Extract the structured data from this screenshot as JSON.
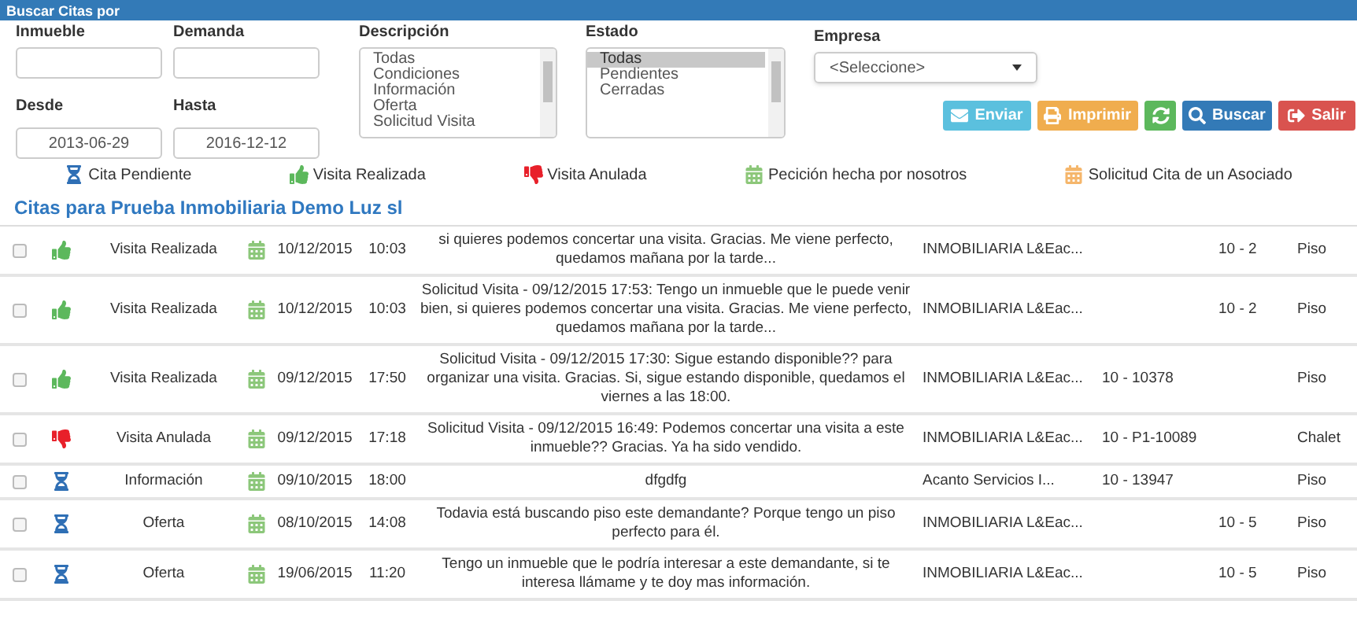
{
  "panel_title": "Buscar Citas por",
  "fields": {
    "inmueble": {
      "label": "Inmueble"
    },
    "demanda": {
      "label": "Demanda"
    },
    "desde": {
      "label": "Desde",
      "value": "2013-06-29"
    },
    "hasta": {
      "label": "Hasta",
      "value": "2016-12-12"
    }
  },
  "descripcion": {
    "label": "Descripción",
    "options": [
      {
        "label": "Todas",
        "selected": false
      },
      {
        "label": "Condiciones",
        "selected": false
      },
      {
        "label": "Información",
        "selected": false
      },
      {
        "label": "Oferta",
        "selected": false
      },
      {
        "label": "Solicitud Visita",
        "selected": false
      }
    ]
  },
  "estado": {
    "label": "Estado",
    "options": [
      {
        "label": "Todas",
        "selected": true
      },
      {
        "label": "Pendientes",
        "selected": false
      },
      {
        "label": "Cerradas",
        "selected": false
      }
    ]
  },
  "empresa": {
    "label": "Empresa",
    "value": "<Seleccione>"
  },
  "buttons": [
    {
      "kind": "send",
      "label": "Enviar"
    },
    {
      "kind": "print",
      "label": "Imprimir"
    },
    {
      "kind": "refresh"
    },
    {
      "kind": "search",
      "label": "Buscar"
    },
    {
      "kind": "exit",
      "label": "Salir"
    }
  ],
  "legend": [
    {
      "kind": "pending",
      "label": "Cita Pendiente"
    },
    {
      "kind": "done",
      "label": "Visita Realizada"
    },
    {
      "kind": "cancelled",
      "label": "Visita Anulada"
    },
    {
      "kind": "own",
      "label": "Pecición hecha por nosotros"
    },
    {
      "kind": "associate",
      "label": "Solicitud Cita de un Asociado"
    }
  ],
  "heading": "Citas para Prueba Inmobiliaria Demo Luz sl",
  "rows": [
    {
      "checked": false,
      "kind": "done",
      "own": true,
      "type": "Visita Realizada",
      "date": "10/12/2015",
      "time": "10:03",
      "description": "si quieres podemos concertar una visita. Gracias. Me viene perfecto, quedamos mañana por la tarde...",
      "company": "INMOBILIARIA L&Eac...",
      "inmueble": "",
      "demanda": "10 - 2",
      "tipo": "Piso"
    },
    {
      "checked": false,
      "kind": "done",
      "own": true,
      "type": "Visita Realizada",
      "date": "10/12/2015",
      "time": "10:03",
      "description": "Solicitud Visita - 09/12/2015 17:53: Tengo un inmueble que le puede venir bien, si quieres podemos concertar una visita. Gracias. Me viene perfecto, quedamos mañana por la tarde...",
      "company": "INMOBILIARIA L&Eac...",
      "inmueble": "",
      "demanda": "10 - 2",
      "tipo": "Piso"
    },
    {
      "checked": false,
      "kind": "done",
      "own": true,
      "type": "Visita Realizada",
      "date": "09/12/2015",
      "time": "17:50",
      "description": "Solicitud Visita - 09/12/2015 17:30: Sigue estando disponible?? para organizar una visita. Gracias. Si, sigue estando disponible, quedamos el viernes a las 18:00.",
      "company": "INMOBILIARIA L&Eac...",
      "inmueble": "10 - 10378",
      "demanda": "",
      "tipo": "Piso"
    },
    {
      "checked": false,
      "kind": "cancelled",
      "own": true,
      "type": "Visita Anulada",
      "date": "09/12/2015",
      "time": "17:18",
      "description": "Solicitud Visita - 09/12/2015 16:49: Podemos concertar una visita a este inmueble?? Gracias. Ya ha sido vendido.",
      "company": "INMOBILIARIA L&Eac...",
      "inmueble": "10 - P1-10089",
      "demanda": "",
      "tipo": "Chalet"
    },
    {
      "checked": false,
      "kind": "pending",
      "own": true,
      "type": "Información",
      "date": "09/10/2015",
      "time": "18:00",
      "description": "dfgdfg",
      "company": "Acanto Servicios I...",
      "inmueble": "10 - 13947",
      "demanda": "",
      "tipo": "Piso"
    },
    {
      "checked": false,
      "kind": "pending",
      "own": true,
      "type": "Oferta",
      "date": "08/10/2015",
      "time": "14:08",
      "description": "Todavia está buscando piso este demandante? Porque tengo un piso perfecto para él.",
      "company": "INMOBILIARIA L&Eac...",
      "inmueble": "",
      "demanda": "10 - 5",
      "tipo": "Piso"
    },
    {
      "checked": false,
      "kind": "pending",
      "own": true,
      "type": "Oferta",
      "date": "19/06/2015",
      "time": "11:20",
      "description": "Tengo un inmueble que le podría interesar a este demandante, si te interesa llámame y te doy mas información.",
      "company": "INMOBILIARIA L&Eac...",
      "inmueble": "",
      "demanda": "10 - 5",
      "tipo": "Piso"
    }
  ]
}
